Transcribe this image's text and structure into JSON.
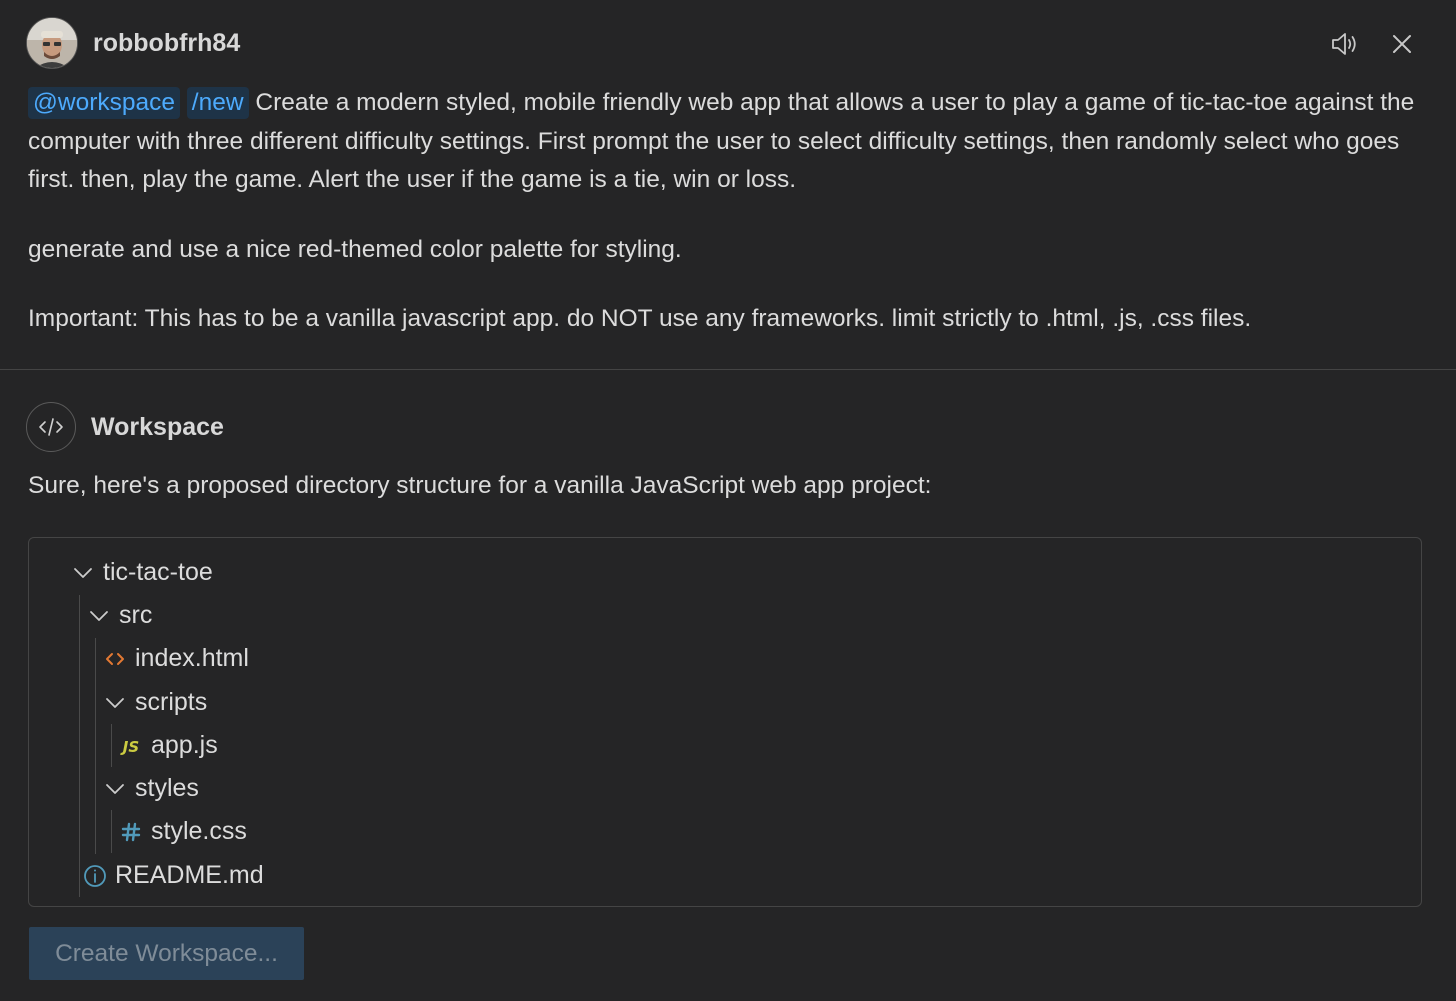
{
  "user": {
    "name": "robbobfrh84"
  },
  "request": {
    "agent_chip": "@workspace",
    "command_chip": "/new",
    "paragraph1": "Create a modern styled, mobile friendly web app that allows a user to play a game of tic-tac-toe against the computer with three different difficulty settings. First prompt the user to select difficulty settings, then randomly select who goes first. then, play the game. Alert the user if the game is a tie, win or loss.",
    "paragraph2": "generate and use a nice red-themed color palette for styling.",
    "paragraph3": "Important: This has to be a vanilla javascript app. do NOT use any frameworks. limit strictly to .html, .js, .css files."
  },
  "response": {
    "agent_name": "Workspace",
    "intro": "Sure, here's a proposed directory structure for a vanilla JavaScript web app project:",
    "tree": {
      "root": "tic-tac-toe",
      "src": "src",
      "index_html": "index.html",
      "scripts": "scripts",
      "app_js": "app.js",
      "styles": "styles",
      "style_css": "style.css",
      "readme": "README.md"
    },
    "create_button": "Create Workspace..."
  },
  "icons": {
    "speaker": "speaker-icon",
    "close": "close-icon",
    "code": "code-icon",
    "chevron": "chevron-down-icon",
    "html": "html-file-icon",
    "js": "js-file-icon",
    "css": "css-file-icon",
    "info": "info-icon"
  },
  "colors": {
    "background": "#252526",
    "chip_bg": "#1e3347",
    "chip_text": "#4daafc",
    "html_icon": "#e37933",
    "js_icon": "#cbcb41",
    "css_icon": "#519aba",
    "info_icon": "#519aba",
    "button_bg": "#2b4258"
  }
}
